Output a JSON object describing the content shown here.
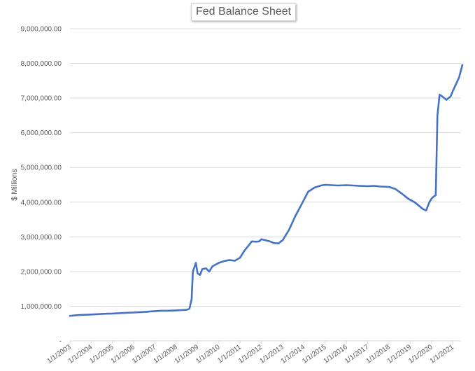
{
  "chart_data": {
    "type": "line",
    "title": "Fed Balance Sheet",
    "xlabel": "",
    "ylabel": "$ Millions",
    "ylim": [
      0,
      9000000
    ],
    "y_ticks": [
      0,
      1000000,
      2000000,
      3000000,
      4000000,
      5000000,
      6000000,
      7000000,
      8000000,
      9000000
    ],
    "y_tick_labels": [
      "-",
      "1,000,000.00",
      "2,000,000.00",
      "3,000,000.00",
      "4,000,000.00",
      "5,000,000.00",
      "6,000,000.00",
      "7,000,000.00",
      "8,000,000.00",
      "9,000,000.00"
    ],
    "x_tick_labels": [
      "1/1/2003",
      "1/1/2004",
      "1/1/2005",
      "1/1/2006",
      "1/1/2007",
      "1/1/2008",
      "1/1/2009",
      "1/1/2010",
      "1/1/2011",
      "1/1/2012",
      "1/1/2013",
      "1/1/2014",
      "1/1/2015",
      "1/1/2016",
      "1/1/2017",
      "1/1/2018",
      "1/1/2019",
      "1/1/2020",
      "1/1/2021"
    ],
    "xlim_years": [
      2003.0,
      2021.45
    ],
    "grid": true,
    "legend": "none",
    "series": [
      {
        "name": "Fed Balance Sheet",
        "color": "#4472c4",
        "x": [
          2003.0,
          2003.3,
          2003.6,
          2004.0,
          2004.3,
          2004.6,
          2005.0,
          2005.3,
          2005.6,
          2006.0,
          2006.3,
          2006.6,
          2007.0,
          2007.3,
          2007.6,
          2008.0,
          2008.3,
          2008.5,
          2008.62,
          2008.72,
          2008.78,
          2008.92,
          2009.0,
          2009.12,
          2009.22,
          2009.4,
          2009.55,
          2009.7,
          2009.85,
          2010.0,
          2010.25,
          2010.5,
          2010.75,
          2011.0,
          2011.2,
          2011.4,
          2011.55,
          2011.75,
          2011.9,
          2012.0,
          2012.2,
          2012.4,
          2012.6,
          2012.8,
          2013.0,
          2013.3,
          2013.6,
          2013.9,
          2014.2,
          2014.5,
          2014.8,
          2015.0,
          2015.3,
          2015.6,
          2016.0,
          2016.3,
          2016.6,
          2017.0,
          2017.3,
          2017.6,
          2018.0,
          2018.3,
          2018.6,
          2018.9,
          2019.2,
          2019.4,
          2019.6,
          2019.75,
          2019.9,
          2020.0,
          2020.12,
          2020.2,
          2020.28,
          2020.38,
          2020.5,
          2020.7,
          2020.9,
          2021.0,
          2021.15,
          2021.3,
          2021.45
        ],
        "values": [
          720000,
          740000,
          750000,
          760000,
          770000,
          780000,
          790000,
          800000,
          810000,
          820000,
          830000,
          840000,
          860000,
          870000,
          870000,
          880000,
          890000,
          900000,
          930000,
          1200000,
          2000000,
          2250000,
          1950000,
          1900000,
          2070000,
          2090000,
          2000000,
          2150000,
          2200000,
          2250000,
          2300000,
          2330000,
          2310000,
          2400000,
          2600000,
          2750000,
          2870000,
          2860000,
          2870000,
          2930000,
          2900000,
          2870000,
          2820000,
          2810000,
          2900000,
          3200000,
          3600000,
          3950000,
          4300000,
          4420000,
          4480000,
          4500000,
          4490000,
          4480000,
          4490000,
          4480000,
          4470000,
          4460000,
          4470000,
          4450000,
          4440000,
          4380000,
          4250000,
          4100000,
          4000000,
          3900000,
          3800000,
          3760000,
          4000000,
          4100000,
          4170000,
          4200000,
          6500000,
          7100000,
          7050000,
          6950000,
          7050000,
          7200000,
          7400000,
          7600000,
          7950000
        ]
      }
    ]
  }
}
